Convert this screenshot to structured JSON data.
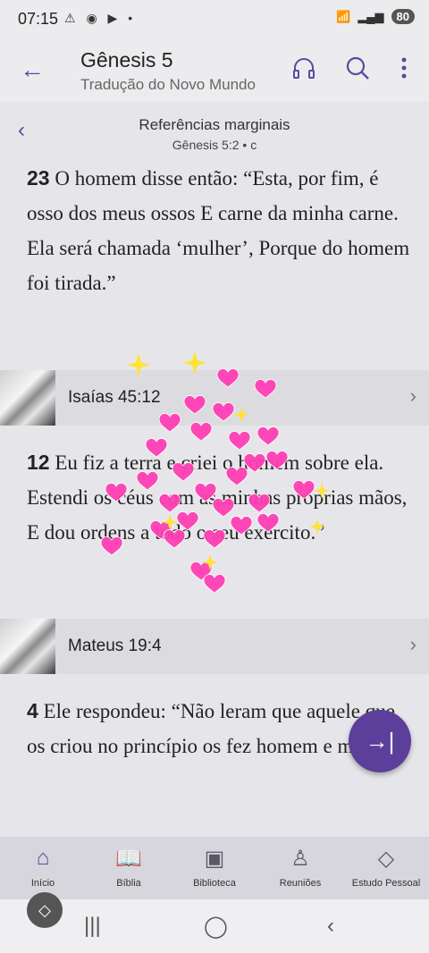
{
  "status": {
    "time": "07:15",
    "battery": "80"
  },
  "header": {
    "title": "Gênesis 5",
    "subtitle": "Tradução do Novo Mundo"
  },
  "refs": {
    "title": "Referências marginais",
    "sub": "Gênesis 5:2 • c"
  },
  "verse1": {
    "num": "23",
    "text": " O homem disse então: “Esta, por fim, é osso dos meus ossos E carne da minha carne. Ela será chamada ‘mulher’, Porque do homem foi tirada.”"
  },
  "ref1": {
    "label": "Isaías 45:12"
  },
  "verse2": {
    "num": "12",
    "text": " Eu fiz a terra e criei o homem sobre ela. Estendi os céus com as minhas próprias mãos, E dou ordens a todo o seu exército.”"
  },
  "ref2": {
    "label": "Mateus 19:4"
  },
  "verse3": {
    "num": "4",
    "text": " Ele respondeu: “Não leram que aquele que os criou no princípio os fez homem e mulher,"
  },
  "nav": [
    {
      "label": "Início"
    },
    {
      "label": "Bíblia"
    },
    {
      "label": "Biblioteca"
    },
    {
      "label": "Reuniões"
    },
    {
      "label": "Estudo Pessoal"
    }
  ],
  "colors": {
    "accent": "#5a4aa0",
    "fab": "#5b3f9b",
    "heart": "#ff3fb5"
  }
}
